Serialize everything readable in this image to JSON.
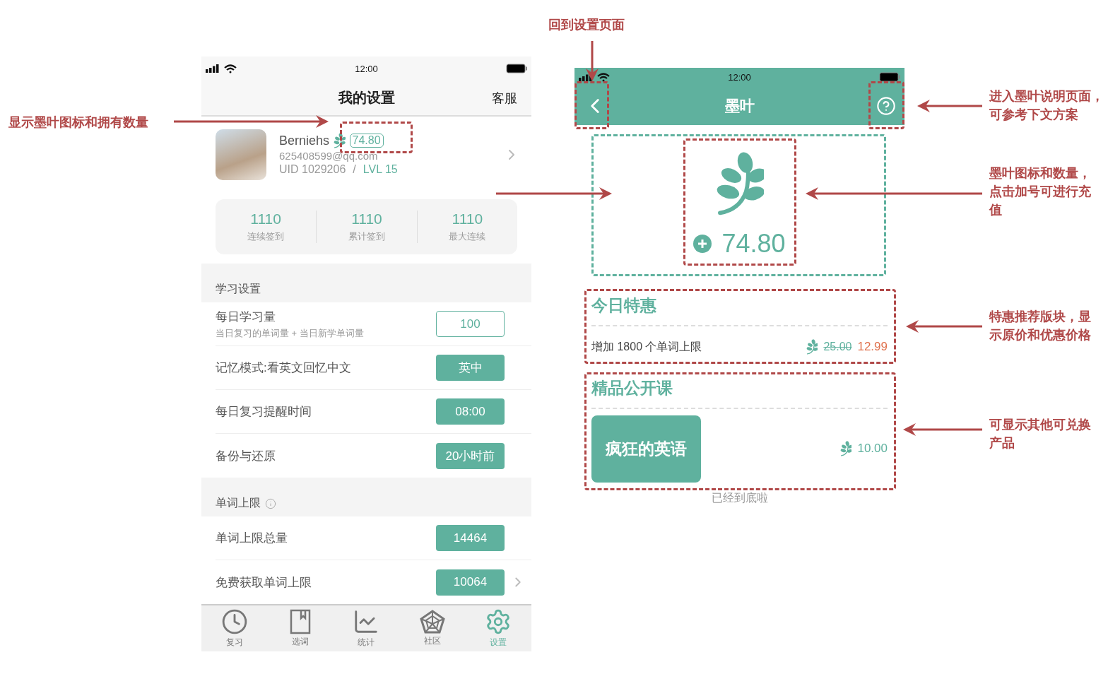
{
  "left_phone": {
    "status_bar": {
      "time": "12:00"
    },
    "nav": {
      "title": "我的设置",
      "action": "客服"
    },
    "profile": {
      "name": "Berniehs",
      "leaf_count": "74.80",
      "email": "625408599@qq.com",
      "uid": "UID 1029206",
      "separator": "/",
      "level": "LVL 15"
    },
    "stats": [
      {
        "value": "1110",
        "label": "连续签到"
      },
      {
        "value": "1110",
        "label": "累计签到"
      },
      {
        "value": "1110",
        "label": "最大连续"
      }
    ],
    "sections": [
      {
        "title": "学习设置",
        "info": false,
        "rows": [
          {
            "label": "每日学习量",
            "sublabel": "当日复习的单词量 + 当日新学单词量",
            "value": "100",
            "kind": "outline",
            "chevron": false
          },
          {
            "label": "记忆模式:看英文回忆中文",
            "value": "英中",
            "kind": "filled",
            "chevron": false
          },
          {
            "label": "每日复习提醒时间",
            "value": "08:00",
            "kind": "filled",
            "chevron": false
          },
          {
            "label": "备份与还原",
            "value": "20小时前",
            "kind": "filled",
            "chevron": false
          }
        ]
      },
      {
        "title": "单词上限",
        "info": true,
        "rows": [
          {
            "label": "单词上限总量",
            "value": "14464",
            "kind": "filled",
            "chevron": false
          },
          {
            "label": "免费获取单词上限",
            "value": "10064",
            "kind": "filled",
            "chevron": true
          }
        ]
      }
    ],
    "tab_bar": [
      {
        "label": "复习",
        "selected": false
      },
      {
        "label": "选词",
        "selected": false
      },
      {
        "label": "统计",
        "selected": false
      },
      {
        "label": "社区",
        "selected": false
      },
      {
        "label": "设置",
        "selected": true
      }
    ]
  },
  "right_phone": {
    "status_bar": {
      "time": "12:00"
    },
    "nav": {
      "title": "墨叶"
    },
    "balance": "74.80",
    "deal": {
      "title": "今日特惠",
      "item": "增加 1800 个单词上限",
      "original_price": "25.00",
      "sale_price": "12.99"
    },
    "courses": {
      "title": "精品公开课",
      "items": [
        {
          "name": "疯狂的英语",
          "price": "10.00"
        }
      ]
    },
    "footer": "已经到底啦"
  },
  "annotations": [
    {
      "text": "回到设置页面"
    },
    {
      "text": "显示墨叶图标和拥有数量"
    },
    {
      "text": "进入墨叶说明页面，可参考下文方案"
    },
    {
      "text": "墨叶图标和数量，点击加号可进行充值"
    },
    {
      "text": "特惠推荐版块，显示原价和优惠价格"
    },
    {
      "text": "可显示其他可兑换产品"
    }
  ]
}
